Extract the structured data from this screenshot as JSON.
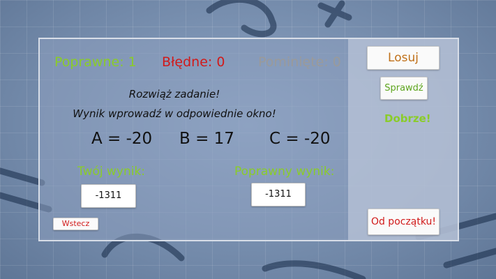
{
  "score": {
    "correct": "Poprawne: 1",
    "wrong": "Błędne: 0",
    "skipped": "Pominięte: 0"
  },
  "instructions": {
    "line1": "Rozwiąż zadanie!",
    "line2": "Wynik wprowadź w odpowiednie okno!"
  },
  "variables": {
    "a": "A = -20",
    "b": "B = 17",
    "c": "C = -20"
  },
  "your_result": {
    "label": "Twój wynik:",
    "value": "-1311"
  },
  "correct_result": {
    "label": "Poprawny wynik:",
    "value": "-1311"
  },
  "buttons": {
    "draw": "Losuj",
    "check": "Sprawdź",
    "back": "Wstecz",
    "restart": "Od początku!"
  },
  "feedback": "Dobrze!",
  "colors": {
    "correct": "#8acc2a",
    "wrong": "#d11a1a",
    "skipped": "#9a9a9a",
    "draw": "#c0711a"
  }
}
